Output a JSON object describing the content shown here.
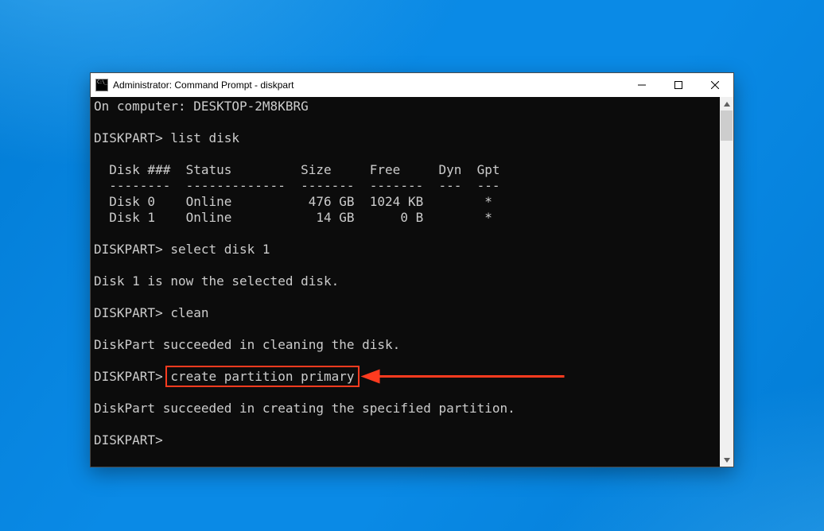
{
  "window": {
    "title": "Administrator: Command Prompt - diskpart"
  },
  "terminal": {
    "line_computer": "On computer: DESKTOP-2M8KBRG",
    "blank1": "",
    "prompt1": "DISKPART> list disk",
    "blank2": "",
    "header": "  Disk ###  Status         Size     Free     Dyn  Gpt",
    "divider": "  --------  -------------  -------  -------  ---  ---",
    "row0": "  Disk 0    Online          476 GB  1024 KB        *",
    "row1": "  Disk 1    Online           14 GB      0 B        *",
    "blank3": "",
    "prompt2": "DISKPART> select disk 1",
    "blank4": "",
    "msg_selected": "Disk 1 is now the selected disk.",
    "blank5": "",
    "prompt3": "DISKPART> clean",
    "blank6": "",
    "msg_clean": "DiskPart succeeded in cleaning the disk.",
    "blank7": "",
    "prompt4_prefix": "DISKPART> ",
    "prompt4_cmd": "create partition primary",
    "blank8": "",
    "msg_created": "DiskPart succeeded in creating the specified partition.",
    "blank9": "",
    "prompt5": "DISKPART>"
  },
  "annotation": {
    "highlight_text": "create partition primary",
    "color": "#ff3b1f"
  }
}
